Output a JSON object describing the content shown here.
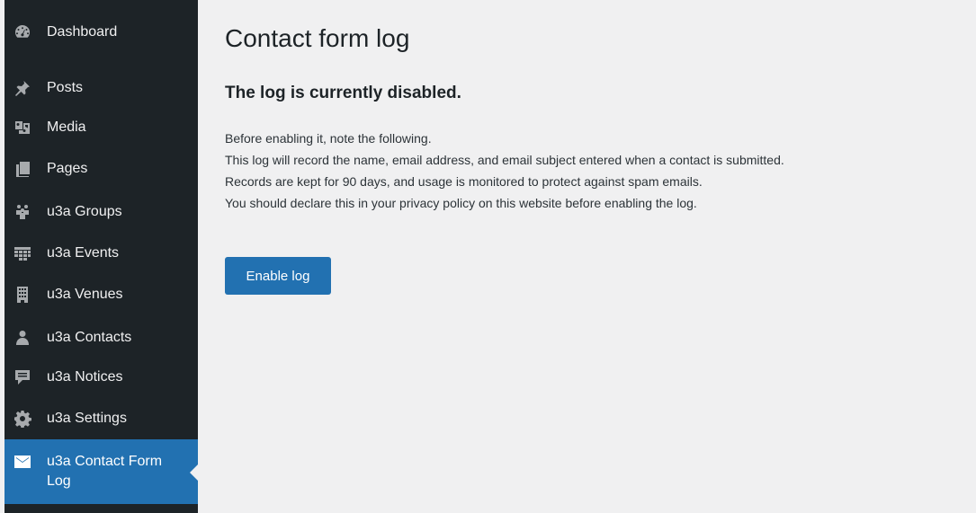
{
  "sidebar": {
    "items": [
      {
        "label": "Dashboard",
        "icon": "dashboard-icon"
      },
      {
        "label": "Posts",
        "icon": "pushpin-icon"
      },
      {
        "label": "Media",
        "icon": "media-icon"
      },
      {
        "label": "Pages",
        "icon": "pages-icon"
      },
      {
        "label": "u3a Groups",
        "icon": "groups-icon"
      },
      {
        "label": "u3a Events",
        "icon": "calendar-icon"
      },
      {
        "label": "u3a Venues",
        "icon": "building-icon"
      },
      {
        "label": "u3a Contacts",
        "icon": "person-icon"
      },
      {
        "label": "u3a Notices",
        "icon": "notice-icon"
      },
      {
        "label": "u3a Settings",
        "icon": "gear-icon"
      },
      {
        "label_line1": "u3a Contact Form",
        "label_line2": "Log",
        "icon": "envelope-icon",
        "active": true
      }
    ]
  },
  "main": {
    "title": "Contact form log",
    "status_heading": "The log is currently disabled.",
    "notes": [
      "Before enabling it, note the following.",
      "This log will record the name, email address, and email subject entered when a contact is submitted.",
      "Records are kept for 90 days, and usage is monitored to protect against spam emails.",
      "You should declare this in your privacy policy on this website before enabling the log."
    ],
    "enable_button": "Enable log"
  },
  "colors": {
    "sidebar_bg": "#1d2327",
    "active_bg": "#2271b1",
    "page_bg": "#f0f0f1",
    "button_bg": "#2271b1"
  }
}
